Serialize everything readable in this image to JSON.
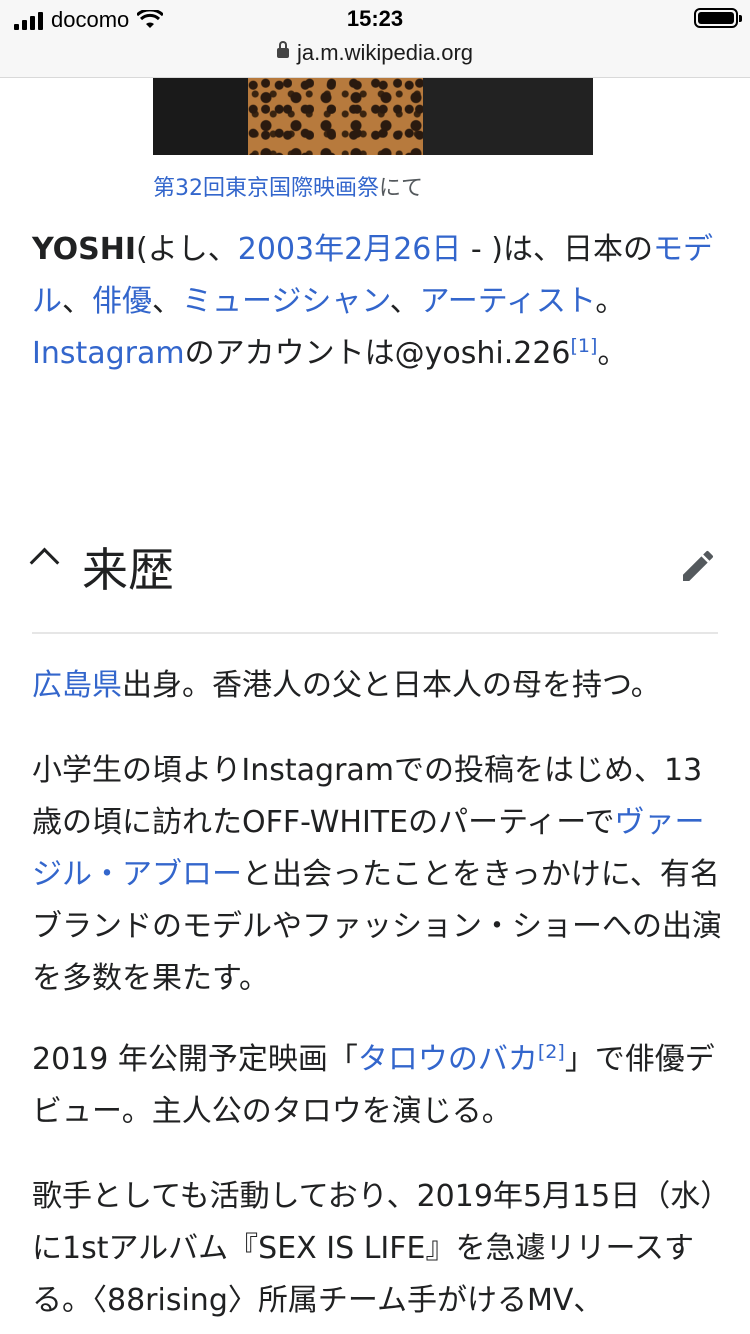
{
  "status": {
    "carrier": "docomo",
    "time": "15:23",
    "url": "ja.m.wikipedia.org"
  },
  "image": {
    "caption_link": "第32回東京国際映画祭",
    "caption_rest": "にて"
  },
  "intro": {
    "name": "YOSHI",
    "t1": "(よし、",
    "date_link": "2003年2月26日",
    "t2": " - )は、日本の",
    "link_model": "モデル",
    "t3": "、",
    "link_actor": "俳優",
    "t4": "、",
    "link_musician": "ミュージシャン",
    "t5": "、",
    "link_artist": "アーティスト",
    "t6": "。",
    "link_instagram": "Instagram",
    "t7": "のアカウントは@yoshi.226",
    "ref": "[1]",
    "t8": "。"
  },
  "section": {
    "title": "来歴",
    "collapse_icon": "chevron-up-icon",
    "edit_icon": "pencil-icon"
  },
  "paragraphs": {
    "p1_link": "広島県",
    "p1_rest": "出身。香港人の父と日本人の母を持つ。",
    "p2_a": "小学生の頃よりInstagramでの投稿をはじめ、13歳の頃に訪れたOFF-WHITEのパーティーで",
    "p2_link": "ヴァージル・アブロー",
    "p2_b": "と出会ったことをきっかけに、有名ブランドのモデルやファッション・ショーへの出演を多数を果たす。",
    "p3_a": "2019 年公開予定映画「",
    "p3_link": "タロウのバカ",
    "p3_ref": "[2]",
    "p3_b": "」で俳優デビュー。主人公のタロウを演じる。",
    "p4": "歌手としても活動しており、2019年5月15日（水）に1stアルバム『SEX IS LIFE』を急遽リリースする。〈88rising〉所属チーム手がけるMV、"
  }
}
